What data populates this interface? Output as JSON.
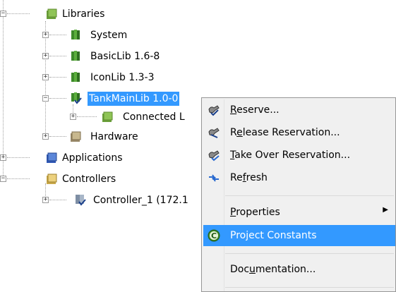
{
  "tree": {
    "libraries": "Libraries",
    "system": "System",
    "basiclib": "BasicLib 1.6-8",
    "iconlib": "IconLib 1.3-3",
    "tankmainlib": "TankMainLib 1.0-0",
    "connected": "Connected L",
    "hardware": "Hardware",
    "applications": "Applications",
    "controllers": "Controllers",
    "controller1": "Controller_1 (172.1"
  },
  "menu": {
    "reserve": {
      "pre": "",
      "acc": "R",
      "post": "eserve..."
    },
    "release": {
      "pre": "R",
      "acc": "e",
      "post": "lease Reservation..."
    },
    "takeover": {
      "pre": "",
      "acc": "T",
      "post": "ake Over Reservation..."
    },
    "refresh": {
      "pre": "Re",
      "acc": "f",
      "post": "resh"
    },
    "properties": {
      "pre": "",
      "acc": "P",
      "post": "roperties"
    },
    "project_constants": "Project Constants",
    "documentation": {
      "pre": "Doc",
      "acc": "u",
      "post": "mentation..."
    }
  },
  "colors": {
    "selection": "#3399ff",
    "menu_bg": "#f0f0f0"
  }
}
